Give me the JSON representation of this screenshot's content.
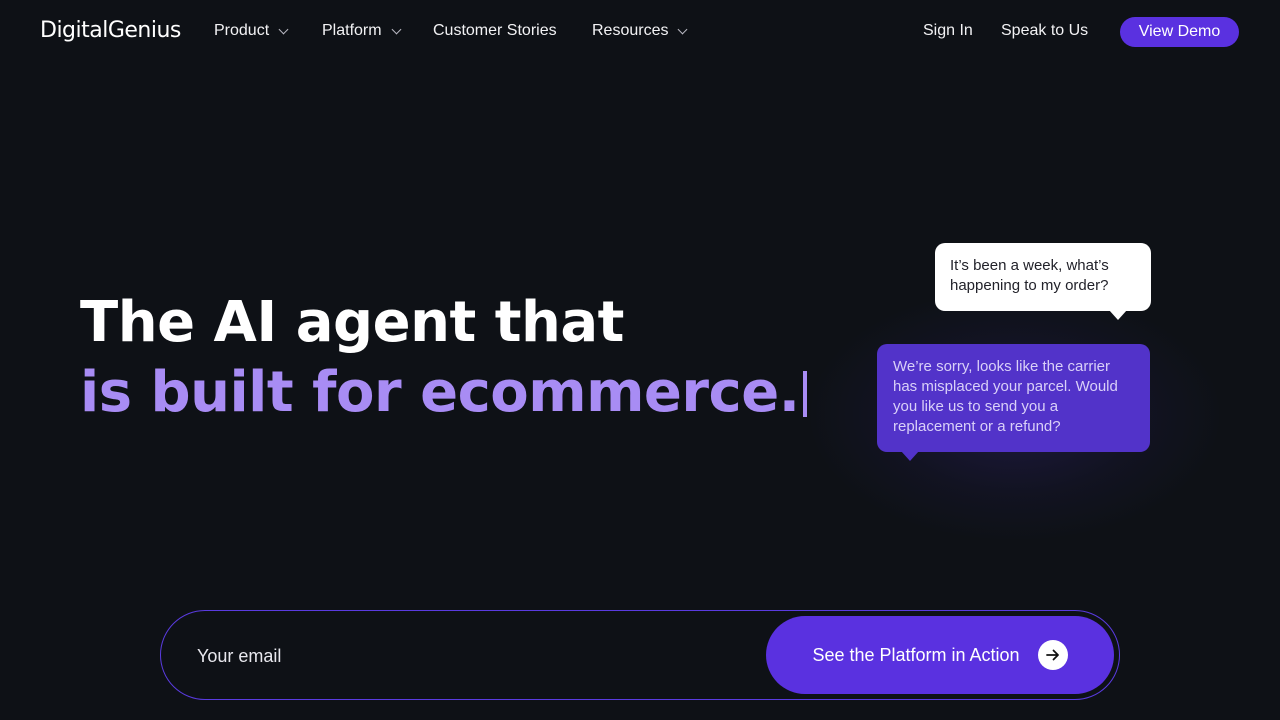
{
  "nav": {
    "logo": "DigitalGenius",
    "items": [
      {
        "label": "Product",
        "has_dropdown": true
      },
      {
        "label": "Platform",
        "has_dropdown": true
      },
      {
        "label": "Customer Stories",
        "has_dropdown": false
      },
      {
        "label": "Resources",
        "has_dropdown": true
      }
    ],
    "sign_in": "Sign In",
    "speak": "Speak to Us",
    "demo": "View Demo"
  },
  "hero": {
    "line1": "The AI agent that",
    "line2": "is built for ecommerce."
  },
  "chat": {
    "user_message": "It’s been a week, what’s happening to my order?",
    "bot_message": "We’re sorry, looks like the carrier has misplaced your parcel. Would you like us to send you a replacement or a refund?"
  },
  "form": {
    "email_placeholder": "Your email",
    "cta_label": "See the Platform in Action"
  },
  "icons": {
    "dropdown": "chevron-down-icon",
    "cta": "arrow-right-icon"
  },
  "colors": {
    "accent": "#5a31e0",
    "highlight_text": "#a88cf4",
    "background": "#0e1116",
    "bot_bubble": "#5233c9"
  }
}
